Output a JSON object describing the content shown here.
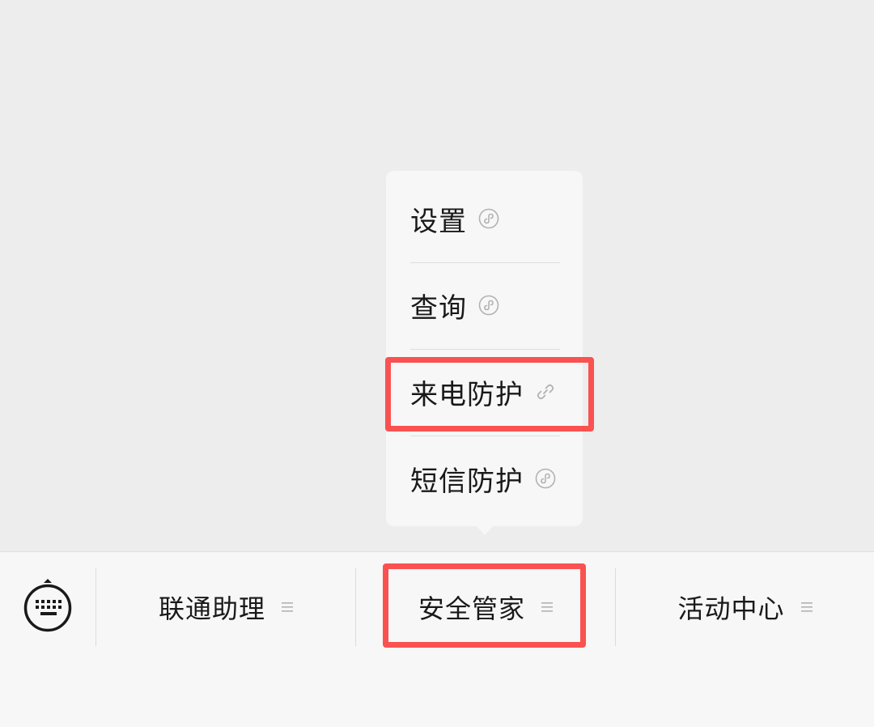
{
  "popup": {
    "items": [
      {
        "label": "设置",
        "icon": "mini-program-icon"
      },
      {
        "label": "查询",
        "icon": "mini-program-icon"
      },
      {
        "label": "来电防护",
        "icon": "link-icon"
      },
      {
        "label": "短信防护",
        "icon": "mini-program-icon"
      }
    ]
  },
  "bottom_bar": {
    "keyboard_icon": "keyboard-icon",
    "menus": [
      {
        "label": "联通助理",
        "icon": "menu-lines-icon"
      },
      {
        "label": "安全管家",
        "icon": "menu-lines-icon"
      },
      {
        "label": "活动中心",
        "icon": "menu-lines-icon"
      }
    ]
  },
  "colors": {
    "highlight": "#fa5151",
    "background": "#ededed",
    "panel": "#f7f7f7"
  }
}
